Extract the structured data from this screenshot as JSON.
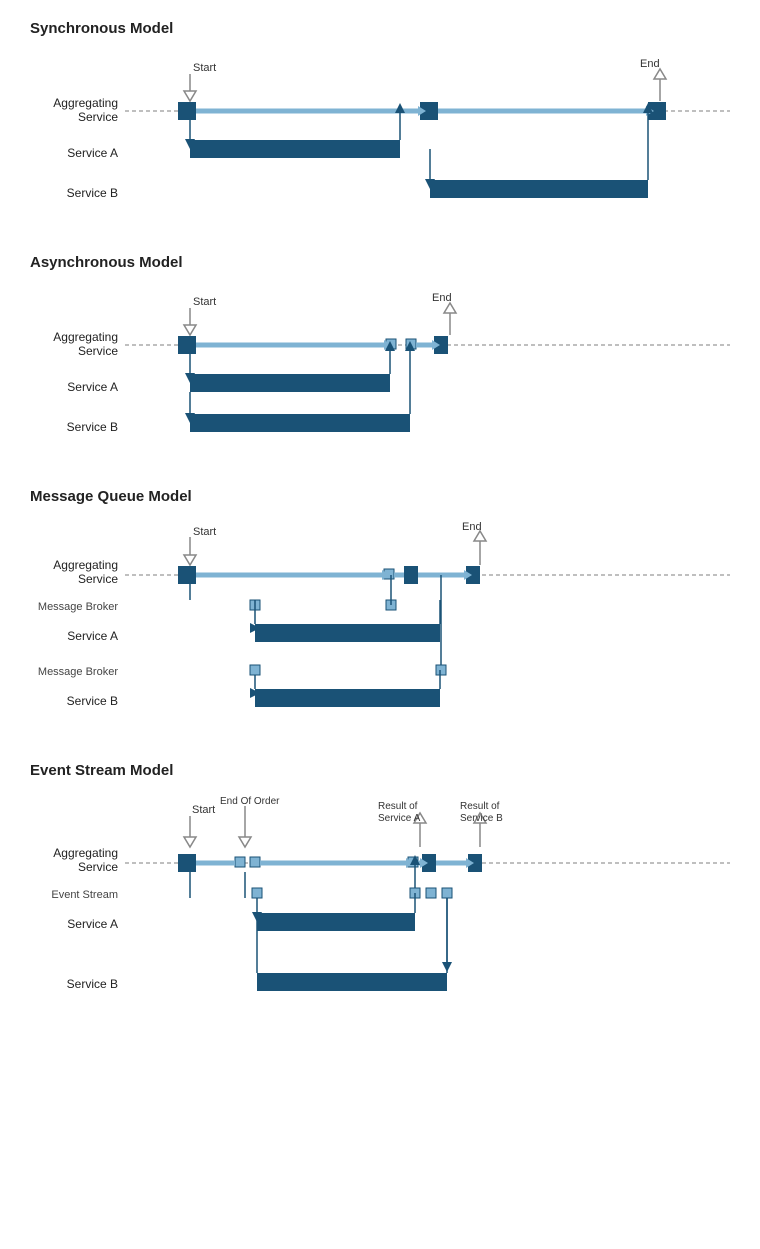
{
  "sections": [
    {
      "id": "sync",
      "title": "Synchronous Model",
      "rows": [
        {
          "label": "Aggregating\nService",
          "type": "agg"
        },
        {
          "label": "Service A",
          "type": "svcA"
        },
        {
          "label": "Service B",
          "type": "svcB"
        }
      ]
    },
    {
      "id": "async",
      "title": "Asynchronous Model",
      "rows": [
        {
          "label": "Aggregating\nService",
          "type": "agg"
        },
        {
          "label": "Service A",
          "type": "svcA"
        },
        {
          "label": "Service B",
          "type": "svcB"
        }
      ]
    },
    {
      "id": "msgqueue",
      "title": "Message Queue Model",
      "rows": [
        {
          "label": "Aggregating\nService",
          "type": "agg"
        },
        {
          "label": "Message Broker",
          "type": "broker"
        },
        {
          "label": "Service A",
          "type": "svcA"
        },
        {
          "label": "Message Broker",
          "type": "broker"
        },
        {
          "label": "Service B",
          "type": "svcB"
        }
      ]
    },
    {
      "id": "eventstream",
      "title": "Event Stream Model",
      "rows": [
        {
          "label": "Aggregating\nService",
          "type": "agg"
        },
        {
          "label": "Event Stream",
          "type": "broker"
        },
        {
          "label": "Service A",
          "type": "svcA"
        },
        {
          "label": "",
          "type": "spacer"
        },
        {
          "label": "Service B",
          "type": "svcB"
        }
      ]
    }
  ],
  "labels": {
    "start": "Start",
    "end": "End",
    "end_of_order": "End Of Order",
    "result_service_a": "Result of\nService A",
    "result_service_b": "Result of\nService B"
  }
}
